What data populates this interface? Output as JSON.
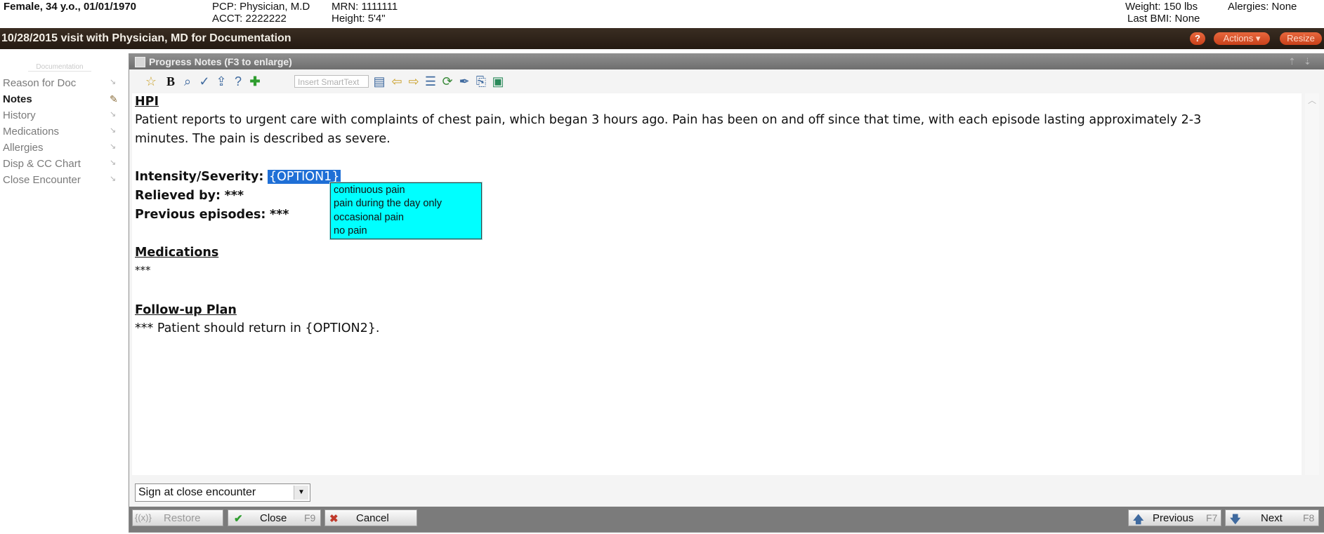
{
  "patient": {
    "summary": "Female, 34 y.o., 01/01/1970",
    "pcp": "PCP: Physician, M.D",
    "acct": "ACCT:  2222222",
    "mrn": "MRN:  1111111",
    "height": "Height:  5'4\"",
    "weight": "Weight:  150 lbs",
    "bmi": "Last BMI: None",
    "allergies": "Alergies:  None"
  },
  "visit": {
    "title": "10/28/2015 visit with Physician, MD for Documentation",
    "help_label": "?",
    "actions_label": "Actions ▾",
    "resize_label": "Resize"
  },
  "nav": {
    "section_title": "Documentation",
    "items": [
      {
        "label": "Reason for Doc",
        "active": false
      },
      {
        "label": "Notes",
        "active": true
      },
      {
        "label": "History",
        "active": false
      },
      {
        "label": "Medications",
        "active": false
      },
      {
        "label": "Allergies",
        "active": false
      },
      {
        "label": "Disp & CC Chart",
        "active": false
      },
      {
        "label": "Close Encounter",
        "active": false
      }
    ]
  },
  "notes": {
    "title": "Progress Notes (F3 to enlarge)",
    "toolbar": {
      "smarttext_placeholder": "Insert SmartText",
      "bold_label": "B"
    },
    "hpi_heading": "HPI",
    "hpi_line1": "Patient reports to urgent care with complaints of chest pain, which began 3 hours ago. Pain has been on and off since that time, with each episode lasting approximately 2-3",
    "hpi_line2": "minutes. The pain is described as severe.",
    "intensity_label": "Intensity/Severity:",
    "intensity_value": "{OPTION1}",
    "relieved_label": "Relieved by:",
    "relieved_value": "***",
    "previous_label": "Previous episodes:",
    "previous_value": "***",
    "medications_heading": "Medications",
    "medications_value": "***",
    "followup_heading": "Follow-up Plan",
    "followup_text": "*** Patient should return in {OPTION2}.",
    "option1_choices": [
      "continuous pain",
      "pain during the day only",
      "occasional pain",
      "no pain"
    ],
    "sign_option": "Sign at close encounter"
  },
  "footer": {
    "restore_label": "Restore",
    "restore_key": "{(x)}",
    "close_label": "Close",
    "close_key": "F9",
    "cancel_label": "Cancel",
    "previous_label": "Previous",
    "previous_key": "F7",
    "next_label": "Next",
    "next_key": "F8"
  }
}
